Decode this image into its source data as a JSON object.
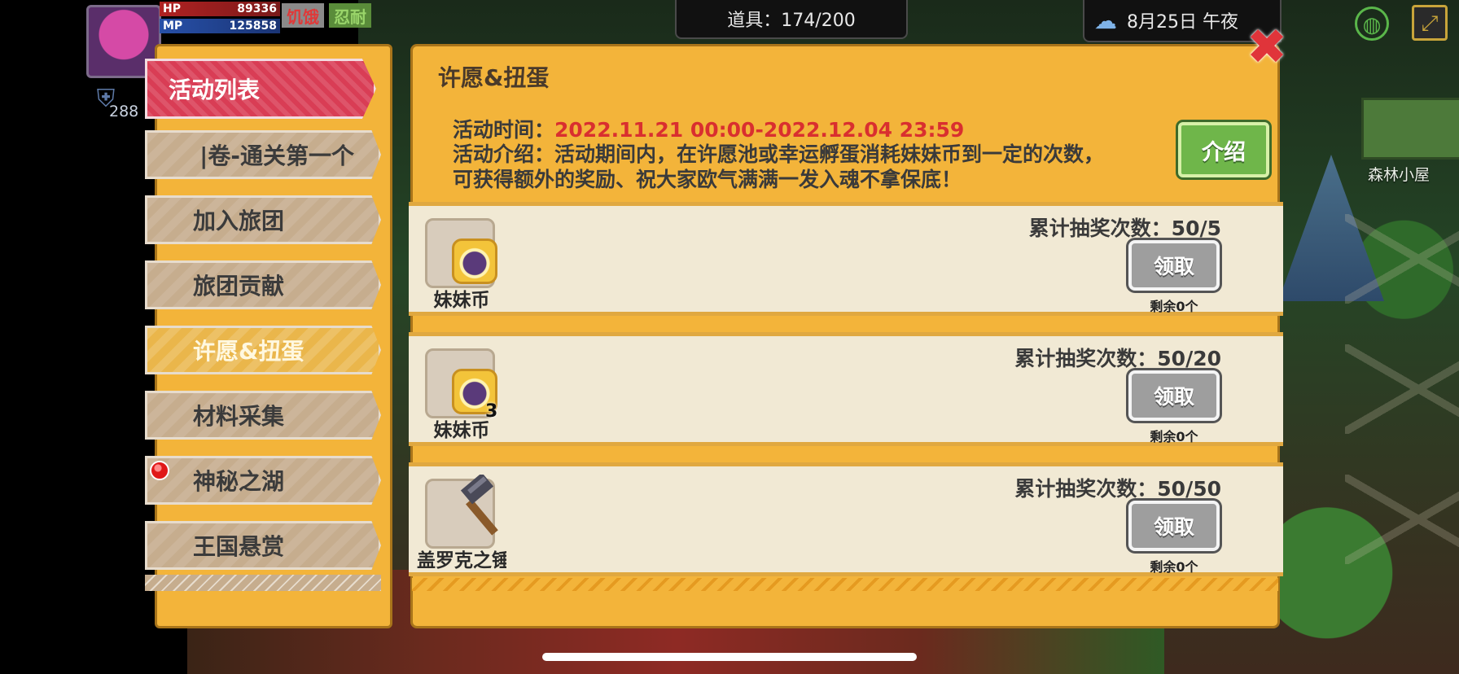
{
  "hud": {
    "hp_label": "HP",
    "hp_value": "89336",
    "mp_label": "MP",
    "mp_value": "125858",
    "hunger_label": "饥饿",
    "endure_label": "忍耐",
    "level": "288",
    "items": "道具：174/200",
    "date": "8月25日 午夜"
  },
  "world": {
    "house_label": "森林小屋"
  },
  "sidebar": {
    "title": "活动列表",
    "items": [
      {
        "label": "|卷-通关第一个"
      },
      {
        "label": "加入旅团"
      },
      {
        "label": "旅团贡献"
      },
      {
        "label": "许愿&扭蛋"
      },
      {
        "label": "材料采集"
      },
      {
        "label": "神秘之湖"
      },
      {
        "label": "王国悬赏"
      }
    ]
  },
  "panel": {
    "title": "许愿&扭蛋",
    "time_label": "活动时间：",
    "time_value": "2022.11.21 00:00-2022.12.04 23:59",
    "desc_line1": "活动介绍：活动期间内，在许愿池或幸运孵蛋消耗妹妹币到一定的次数，",
    "desc_line2": "可获得额外的奖励、祝大家欧气满满一发入魂不拿保底！",
    "intro_button": "介绍",
    "close_symbol": "✖"
  },
  "rewards": [
    {
      "item_name": "妹妹币",
      "count": "",
      "progress": "累计抽奖次数：50/5",
      "button": "领取",
      "remaining": "剩余0个"
    },
    {
      "item_name": "妹妹币",
      "count": "3",
      "progress": "累计抽奖次数：50/20",
      "button": "领取",
      "remaining": "剩余0个"
    },
    {
      "item_name": "盖罗克之锤",
      "count": "",
      "progress": "累计抽奖次数：50/50",
      "button": "领取",
      "remaining": "剩余0个"
    }
  ]
}
